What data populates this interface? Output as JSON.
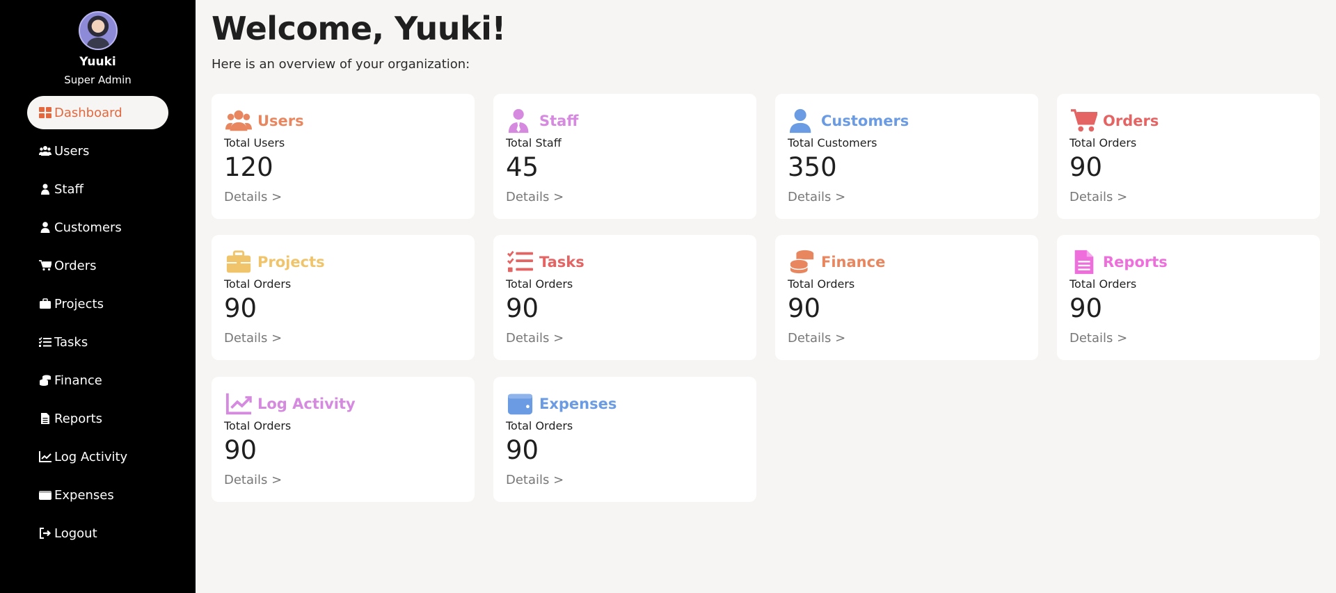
{
  "user": {
    "name": "Yuuki",
    "role": "Super Admin"
  },
  "nav": [
    {
      "label": "Dashboard",
      "icon": "dashboard-icon"
    },
    {
      "label": "Users",
      "icon": "users-icon"
    },
    {
      "label": "Staff",
      "icon": "staff-icon"
    },
    {
      "label": "Customers",
      "icon": "customer-icon"
    },
    {
      "label": "Orders",
      "icon": "cart-icon"
    },
    {
      "label": "Projects",
      "icon": "briefcase-icon"
    },
    {
      "label": "Tasks",
      "icon": "tasks-icon"
    },
    {
      "label": "Finance",
      "icon": "coins-icon"
    },
    {
      "label": "Reports",
      "icon": "report-icon"
    },
    {
      "label": "Log Activity",
      "icon": "chart-line-icon"
    },
    {
      "label": "Expenses",
      "icon": "wallet-icon"
    },
    {
      "label": "Logout",
      "icon": "logout-icon"
    }
  ],
  "main": {
    "title": "Welcome, Yuuki!",
    "subtitle": "Here is an overview of your organization:"
  },
  "cards": [
    {
      "title": "Users",
      "label": "Total Users",
      "value": "120",
      "link": "Details >",
      "icon": "users-icon",
      "color": "#e8875f"
    },
    {
      "title": "Staff",
      "label": "Total Staff",
      "value": "45",
      "link": "Details >",
      "icon": "staff-icon",
      "color": "#d58ae0"
    },
    {
      "title": "Customers",
      "label": "Total Customers",
      "value": "350",
      "link": "Details >",
      "icon": "customer-icon",
      "color": "#6a9be3"
    },
    {
      "title": "Orders",
      "label": "Total Orders",
      "value": "90",
      "link": "Details >",
      "icon": "cart-icon",
      "color": "#e46363"
    },
    {
      "title": "Projects",
      "label": "Total Orders",
      "value": "90",
      "link": "Details >",
      "icon": "briefcase-icon",
      "color": "#f0c46a"
    },
    {
      "title": "Tasks",
      "label": "Total Orders",
      "value": "90",
      "link": "Details >",
      "icon": "tasks-icon",
      "color": "#e46363"
    },
    {
      "title": "Finance",
      "label": "Total Orders",
      "value": "90",
      "link": "Details >",
      "icon": "coins-icon",
      "color": "#e8875f"
    },
    {
      "title": "Reports",
      "label": "Total Orders",
      "value": "90",
      "link": "Details >",
      "icon": "report-icon",
      "color": "#ee6fdc"
    },
    {
      "title": "Log Activity",
      "label": "Total Orders",
      "value": "90",
      "link": "Details >",
      "icon": "chart-line-icon",
      "color": "#d58ae0"
    },
    {
      "title": "Expenses",
      "label": "Total Orders",
      "value": "90",
      "link": "Details >",
      "icon": "wallet-icon",
      "color": "#6a9be3"
    }
  ]
}
